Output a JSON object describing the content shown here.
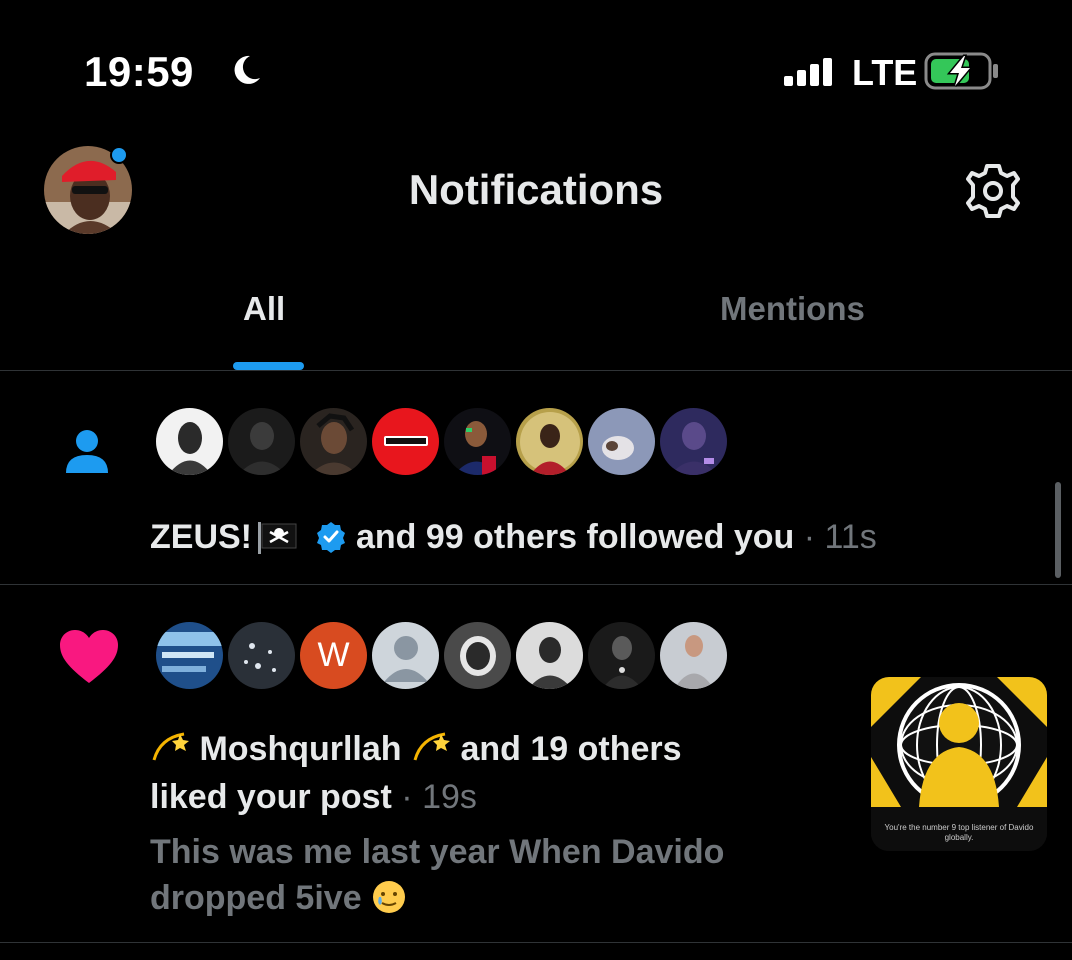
{
  "status_bar": {
    "time": "19:59",
    "network": "LTE",
    "icons": [
      "moon-icon",
      "signal-icon",
      "battery-charging-icon"
    ]
  },
  "header": {
    "title": "Notifications",
    "avatar_icon": "profile-avatar",
    "settings_icon": "gear-icon"
  },
  "tabs": [
    {
      "label": "All",
      "active": true
    },
    {
      "label": "Mentions",
      "active": false
    }
  ],
  "notifications": [
    {
      "type_icon": "person-icon",
      "actor": "ZEUS!",
      "actor_flag": "🏴‍☠️",
      "verified": true,
      "action": "and 99 others followed you",
      "separator": "·",
      "time": "11s",
      "avatar_count": 8
    },
    {
      "type_icon": "heart-icon",
      "actor": "Moshqurllah",
      "actor_emoji": "💫",
      "action_line1": "and 19 others",
      "action_line2": "liked your post",
      "separator": "·",
      "time": "19s",
      "snippet_line1": "This was me last year When Davido",
      "snippet_line2": "dropped 5ive",
      "snippet_emoji": "🥲",
      "avatar_count": 8,
      "avatar_letter": "W",
      "thumbnail_caption": "You're the number 9 top listener of Davido globally."
    }
  ],
  "colors": {
    "accent": "#1d9bf0",
    "like": "#f91880",
    "text": "#e7e9ea",
    "muted": "#71767b",
    "divider": "#2f3336"
  }
}
